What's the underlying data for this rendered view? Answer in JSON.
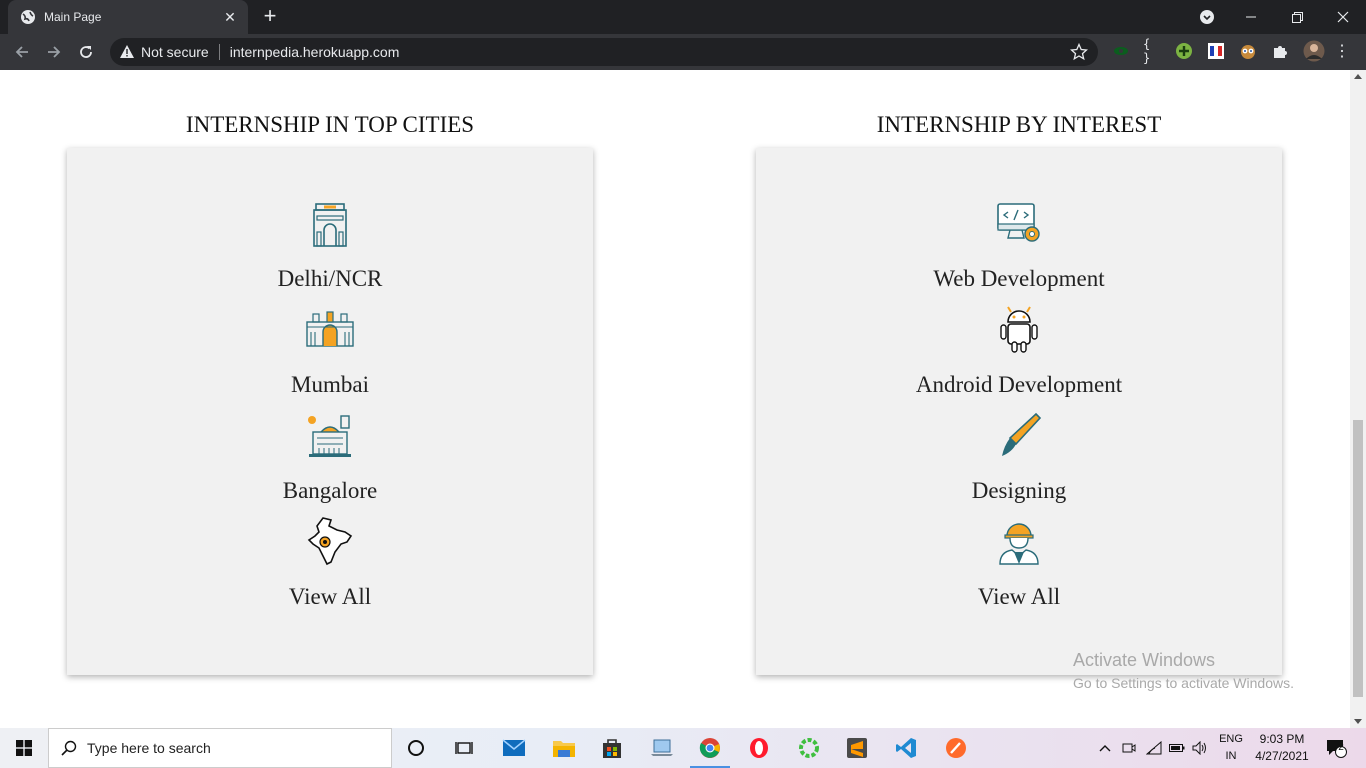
{
  "browser": {
    "tab_title": "Main Page",
    "new_tab": "+",
    "security_text": "Not secure",
    "url": "internpedia.herokuapp.com",
    "extensions": [
      "eye-extension-icon",
      "braces-extension-icon",
      "plus-extension-icon",
      "flag-extension-icon",
      "owl-extension-icon",
      "puzzle-extension-icon",
      "profile-avatar-icon"
    ]
  },
  "sections": {
    "cities": {
      "title": "INTERNSHIP IN TOP CITIES",
      "items": [
        {
          "label": "Delhi/NCR",
          "icon": "india-gate-icon"
        },
        {
          "label": "Mumbai",
          "icon": "gateway-of-india-icon"
        },
        {
          "label": "Bangalore",
          "icon": "bangalore-palace-icon"
        },
        {
          "label": "View All",
          "icon": "india-map-icon"
        }
      ]
    },
    "interests": {
      "title": "INTERNSHIP BY INTEREST",
      "items": [
        {
          "label": "Web Development",
          "icon": "web-development-icon"
        },
        {
          "label": "Android Development",
          "icon": "android-icon"
        },
        {
          "label": "Designing",
          "icon": "paint-brush-icon"
        },
        {
          "label": "View All",
          "icon": "worker-icon"
        }
      ]
    }
  },
  "watermark": {
    "line1": "Activate Windows",
    "line2": "Go to Settings to activate Windows."
  },
  "taskbar": {
    "search_placeholder": "Type here to search",
    "lang_top": "ENG",
    "lang_bottom": "IN",
    "time": "9:03 PM",
    "date": "4/27/2021",
    "notifications": "2"
  },
  "colors": {
    "chrome_dark": "#202124",
    "chrome_toolbar": "#35363a",
    "card_bg": "#f1f1f1",
    "icon_orange": "#f4a323",
    "icon_teal": "#2b6c7a"
  }
}
